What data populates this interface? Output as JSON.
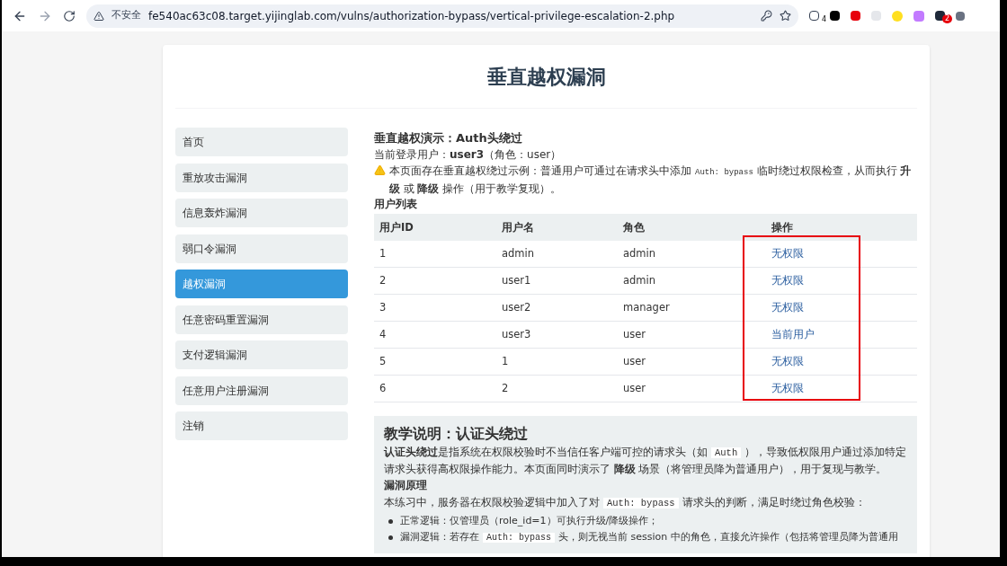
{
  "browser": {
    "security_label": "不安全",
    "url": "fe540ac63c08.target.yijinglab.com/vulns/authorization-bypass/vertical-privilege-escalation-2.php",
    "extension_badges": [
      "4",
      "2"
    ]
  },
  "page_title": "垂直越权漏洞",
  "sidebar": {
    "items": [
      {
        "label": "首页",
        "selected": false
      },
      {
        "label": "重放攻击漏洞",
        "selected": false
      },
      {
        "label": "信息轰炸漏洞",
        "selected": false
      },
      {
        "label": "弱口令漏洞",
        "selected": false
      },
      {
        "label": "越权漏洞",
        "selected": true
      },
      {
        "label": "任意密码重置漏洞",
        "selected": false
      },
      {
        "label": "支付逻辑漏洞",
        "selected": false
      },
      {
        "label": "任意用户注册漏洞",
        "selected": false
      },
      {
        "label": "注销",
        "selected": false
      }
    ]
  },
  "demo": {
    "heading": "垂直越权演示：Auth头绕过",
    "current_user": "当前登录用户：**user3**（角色：user）",
    "warning": [
      {
        "kind": "text",
        "text": "本页面存在垂直越权绕过示例：普通用户可通过在请求头中添加"
      },
      {
        "kind": "code",
        "text": "Auth: bypass"
      },
      {
        "kind": "text",
        "text": "临时绕过权限检查，从而执行 **升级** 或 **降级** 操作（用于教学复现）。"
      }
    ],
    "table_title": "用户列表"
  },
  "table": {
    "columns": [
      {
        "label": "用户ID",
        "highlighted": false
      },
      {
        "label": "用户名",
        "highlighted": false
      },
      {
        "label": "角色",
        "highlighted": false
      },
      {
        "label": "操作",
        "highlighted": true
      }
    ],
    "rows": [
      [
        "1",
        "admin",
        "admin",
        "无权限"
      ],
      [
        "2",
        "user1",
        "admin",
        "无权限"
      ],
      [
        "3",
        "user2",
        "manager",
        "无权限"
      ],
      [
        "4",
        "user3",
        "user",
        "当前用户"
      ],
      [
        "5",
        "1",
        "user",
        "无权限"
      ],
      [
        "6",
        "2",
        "user",
        "无权限"
      ]
    ]
  },
  "explanation": {
    "heading": "教学说明：认证头绕过",
    "intro": [
      {
        "kind": "text",
        "text": "**认证头绕过**是指系统在权限校验时不当信任客户端可控的请求头（如"
      },
      {
        "kind": "code",
        "text": "Auth"
      },
      {
        "kind": "text",
        "text": "），导致低权限用户通过添加特定请求头获得高权限操作能力。本页面同时演示了 **降级** 场景（将管理员降为普通用户），用于复现与教学。"
      }
    ],
    "subheading": "漏洞原理",
    "principle": [
      {
        "kind": "text",
        "text": "本练习中，服务器在权限校验逻辑中加入了对"
      },
      {
        "kind": "code",
        "text": "Auth: bypass"
      },
      {
        "kind": "text",
        "text": "请求头的判断，满足时绕过角色校验："
      }
    ],
    "bullets": [
      [
        {
          "kind": "text",
          "text": "正常逻辑：仅管理员（role_id=1）可执行升级/降级操作；"
        }
      ],
      [
        {
          "kind": "text",
          "text": "漏洞逻辑：若存在"
        },
        {
          "kind": "code",
          "text": "Auth: bypass"
        },
        {
          "kind": "text",
          "text": "头，则无视当前 session 中的角色，直接允许操作（包括将管理员降为普通用"
        }
      ]
    ]
  }
}
